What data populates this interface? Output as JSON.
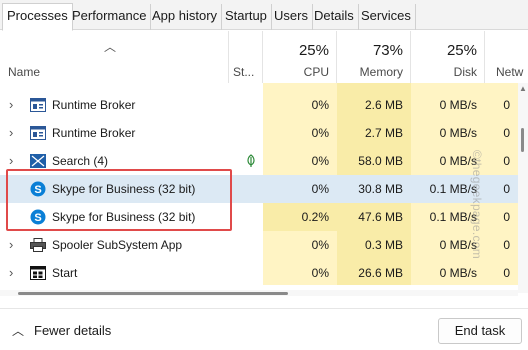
{
  "tabs": [
    "Processes",
    "Performance",
    "App history",
    "Startup",
    "Users",
    "Details",
    "Services"
  ],
  "header": {
    "name": "Name",
    "status": "St...",
    "cpu_pct": "25%",
    "cpu": "CPU",
    "mem_pct": "73%",
    "mem": "Memory",
    "disk_pct": "25%",
    "disk": "Disk",
    "net": "Netw"
  },
  "rows": [
    {
      "name": "Runtime Broker",
      "icon": "runtime-broker-icon",
      "cpu": "0%",
      "mem": "2.6 MB",
      "disk": "0 MB/s",
      "net": "0"
    },
    {
      "name": "Runtime Broker",
      "icon": "runtime-broker-icon",
      "cpu": "0%",
      "mem": "2.7 MB",
      "disk": "0 MB/s",
      "net": "0"
    },
    {
      "name": "Search (4)",
      "icon": "search-app-icon",
      "cpu": "0%",
      "mem": "58.0 MB",
      "disk": "0 MB/s",
      "net": "0"
    },
    {
      "name": "Skype for Business (32 bit)",
      "icon": "skype-icon",
      "cpu": "0%",
      "mem": "30.8 MB",
      "disk": "0.1 MB/s",
      "net": "0"
    },
    {
      "name": "Skype for Business (32 bit)",
      "icon": "skype-icon",
      "cpu": "0.2%",
      "mem": "47.6 MB",
      "disk": "0.1 MB/s",
      "net": "0"
    },
    {
      "name": "Spooler SubSystem App",
      "icon": "printer-icon",
      "cpu": "0%",
      "mem": "0.3 MB",
      "disk": "0 MB/s",
      "net": "0"
    },
    {
      "name": "Start",
      "icon": "start-icon",
      "cpu": "0%",
      "mem": "26.6 MB",
      "disk": "0 MB/s",
      "net": "0"
    }
  ],
  "footer": {
    "fewer_details": "Fewer details",
    "end_task": "End task"
  },
  "watermark": "©thegeekpage.com",
  "colors": {
    "heat_light": "#fff4c4",
    "heat_med": "#f9eca8",
    "selected": "#dce9f4",
    "highlight_box": "#e04a4a"
  }
}
